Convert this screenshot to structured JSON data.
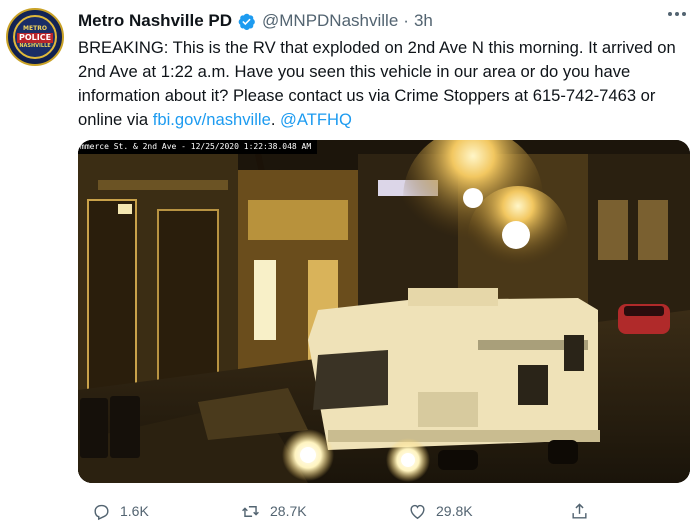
{
  "tweet": {
    "author_name": "Metro Nashville PD",
    "handle": "@MNPDNashville",
    "separator": "·",
    "time": "3h",
    "text_main": "BREAKING: This is the RV that exploded on 2nd Ave N this morning. It arrived on 2nd Ave at 1:22 a.m. Have you seen this vehicle in our area or do you have information about it? Please contact us via Crime Stoppers at 615-742-7463 or online via ",
    "link_1": "fbi.gov/nashville",
    "text_sep": ". ",
    "link_2": "@ATFHQ"
  },
  "avatar": {
    "line1": "METRO",
    "line2": "POLICE",
    "line3": "NASHVILLE"
  },
  "media": {
    "camera_stamp": "mmerce St. & 2nd Ave - 12/25/2020 1:22:38.048 AM"
  },
  "actions": {
    "replies": "1.6K",
    "retweets": "28.7K",
    "likes": "29.8K"
  },
  "colors": {
    "link": "#1d9bf0",
    "verified": "#1d9bf0",
    "secondary_text": "#536471"
  },
  "icons": [
    "verified-badge-icon",
    "more-options-icon",
    "reply-icon",
    "retweet-icon",
    "like-icon",
    "share-icon"
  ]
}
